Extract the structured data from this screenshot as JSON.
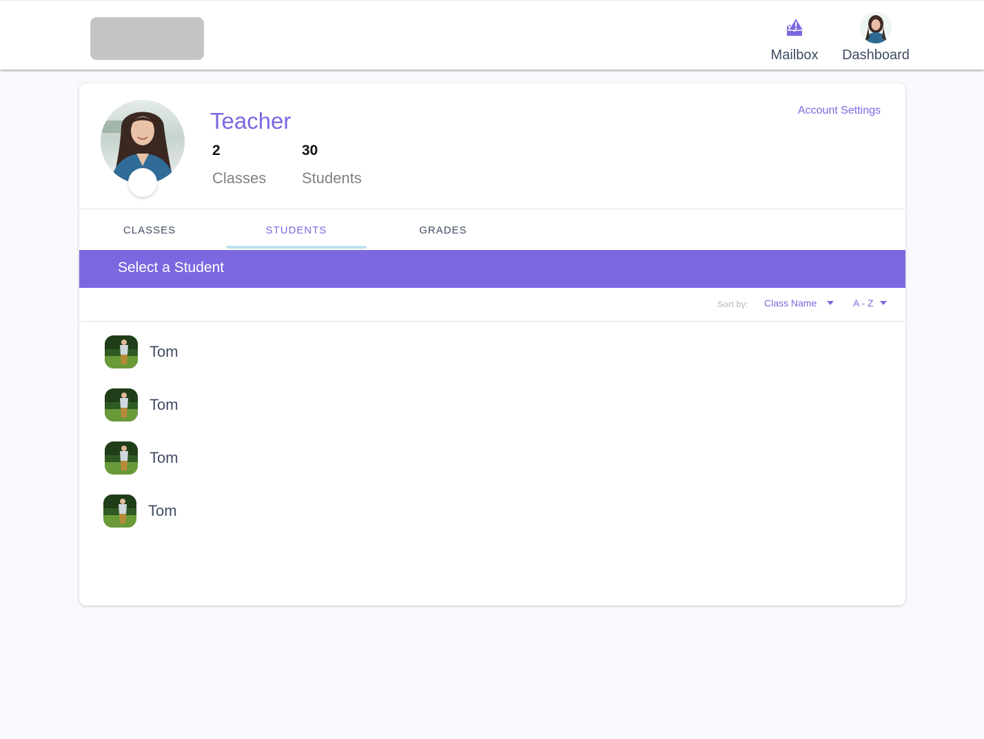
{
  "header": {
    "nav": {
      "mailbox_label": "Mailbox",
      "dashboard_label": "Dashboard"
    }
  },
  "profile": {
    "role": "Teacher",
    "stats": [
      {
        "value": "2",
        "label": "Classes"
      },
      {
        "value": "30",
        "label": "Students"
      }
    ],
    "account_settings_label": "Account Settings"
  },
  "tabs": [
    {
      "label": "CLASSES",
      "active": false
    },
    {
      "label": "STUDENTS",
      "active": true
    },
    {
      "label": "GRADES",
      "active": false
    }
  ],
  "section": {
    "title": "Select a Student"
  },
  "sort": {
    "label": "Sort by:",
    "field_value": "Class Name",
    "order_value": "A - Z"
  },
  "students": [
    {
      "name": "Tom"
    },
    {
      "name": "Tom"
    },
    {
      "name": "Tom"
    },
    {
      "name": "Tom"
    }
  ],
  "colors": {
    "accent": "#7b68e0",
    "tab_indicator": "#bde0f2",
    "logo_placeholder": "#c4c4c4"
  },
  "icons": {
    "mailbox": "mailbox-warning-icon",
    "caret": "caret-down-icon"
  }
}
